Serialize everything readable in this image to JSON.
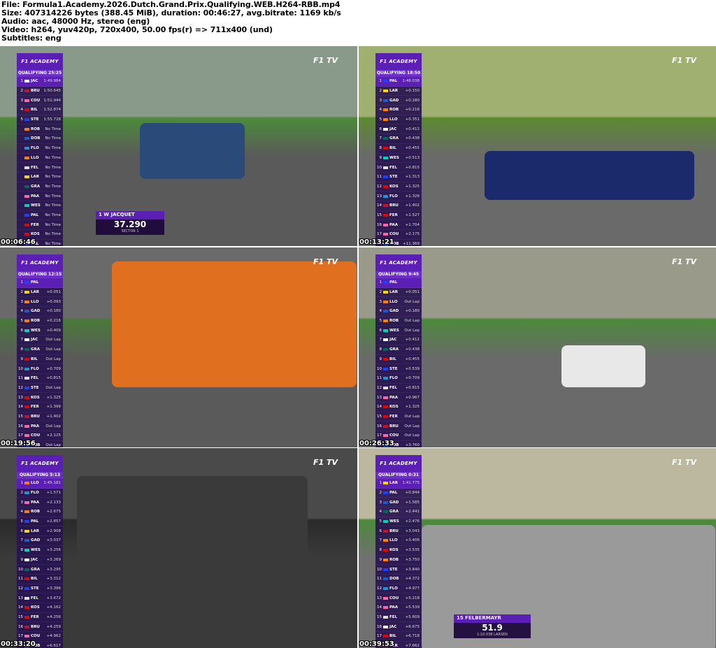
{
  "header": {
    "file": "File: Formula1.Academy.2026.Dutch.Grand.Prix.Qualifying.WEB.H264-RBB.mp4",
    "size": "Size: 407314226 bytes (388.45 MiB), duration: 00:46:27, avg.bitrate: 1169 kb/s",
    "audio": "Audio: aac, 48000 Hz, stereo (eng)",
    "video": "Video: h264, yuv420p, 720x400, 50.00 fps(r) => 711x400 (und)",
    "subtitles": "Subtitles: eng"
  },
  "broadcast": {
    "logo": "F1 ACADEMY",
    "network": "F1 TV"
  },
  "thumbnails": [
    {
      "timestamp": "00:06:46",
      "session": "QUALIFYING 25:25",
      "scene_colors": {
        "sky": "#8a9a8a",
        "track": "#5a5a5a",
        "grass": "#4c8a3a"
      },
      "rows": [
        {
          "p": "1",
          "code": "JAC",
          "gap": "1:49.984",
          "c": "#ffffff"
        },
        {
          "p": "2",
          "code": "BRU",
          "gap": "1:50.645",
          "c": "#c8102e"
        },
        {
          "p": "3",
          "code": "COU",
          "gap": "1:51.944",
          "c": "#ff66aa"
        },
        {
          "p": "4",
          "code": "BIL",
          "gap": "1:52.874",
          "c": "#e10600"
        },
        {
          "p": "5",
          "code": "STE",
          "gap": "1:55.728",
          "c": "#1e41ff"
        },
        {
          "p": "",
          "code": "ROB",
          "gap": "No Time",
          "c": "#ff8000"
        },
        {
          "p": "",
          "code": "DOB",
          "gap": "No Time",
          "c": "#1e5bc6"
        },
        {
          "p": "",
          "code": "FLO",
          "gap": "No Time",
          "c": "#2293d1"
        },
        {
          "p": "",
          "code": "LLO",
          "gap": "No Time",
          "c": "#ff8000"
        },
        {
          "p": "",
          "code": "FEL",
          "gap": "No Time",
          "c": "#dddddd"
        },
        {
          "p": "",
          "code": "LAR",
          "gap": "No Time",
          "c": "#ffd700"
        },
        {
          "p": "",
          "code": "GRA",
          "gap": "No Time",
          "c": "#00665e"
        },
        {
          "p": "",
          "code": "PAA",
          "gap": "No Time",
          "c": "#ff66aa"
        },
        {
          "p": "",
          "code": "WES",
          "gap": "No Time",
          "c": "#00d2be"
        },
        {
          "p": "",
          "code": "PAL",
          "gap": "No Time",
          "c": "#1e41ff"
        },
        {
          "p": "",
          "code": "FER",
          "gap": "No Time",
          "c": "#e10600"
        },
        {
          "p": "",
          "code": "KOS",
          "gap": "No Time",
          "c": "#e10600"
        },
        {
          "p": "",
          "code": "PAL",
          "gap": "No Time",
          "c": "#1e41ff"
        },
        {
          "p": "",
          "code": "GAD",
          "gap": "No Time",
          "c": "#1e5bc6"
        }
      ],
      "lower": {
        "header": "1  W  JACQUET",
        "value": "37.290",
        "sub": "SECTOR 1"
      }
    },
    {
      "timestamp": "00:13:21",
      "session": "QUALIFYING 18:50",
      "scene_colors": {
        "sky": "#a0b070",
        "track": "#6a6a6a",
        "grass": "#5c8a30"
      },
      "rows": [
        {
          "p": "1",
          "code": "PAL",
          "gap": "1:48.038",
          "c": "#1e41ff"
        },
        {
          "p": "2",
          "code": "LAR",
          "gap": "+0.150",
          "c": "#ffd700"
        },
        {
          "p": "3",
          "code": "GAD",
          "gap": "+0.180",
          "c": "#1e5bc6"
        },
        {
          "p": "4",
          "code": "ROB",
          "gap": "+0.216",
          "c": "#ff8000"
        },
        {
          "p": "5",
          "code": "LLO",
          "gap": "+0.351",
          "c": "#ff8000"
        },
        {
          "p": "6",
          "code": "JAC",
          "gap": "+0.412",
          "c": "#ffffff"
        },
        {
          "p": "7",
          "code": "GRA",
          "gap": "+0.438",
          "c": "#00665e"
        },
        {
          "p": "8",
          "code": "BIL",
          "gap": "+0.455",
          "c": "#e10600"
        },
        {
          "p": "9",
          "code": "WES",
          "gap": "+0.513",
          "c": "#00d2be"
        },
        {
          "p": "10",
          "code": "FEL",
          "gap": "+0.815",
          "c": "#dddddd"
        },
        {
          "p": "11",
          "code": "STE",
          "gap": "+1.313",
          "c": "#1e41ff"
        },
        {
          "p": "12",
          "code": "KOS",
          "gap": "+1.325",
          "c": "#e10600"
        },
        {
          "p": "13",
          "code": "FLO",
          "gap": "+1.326",
          "c": "#2293d1"
        },
        {
          "p": "14",
          "code": "BRU",
          "gap": "+1.402",
          "c": "#c8102e"
        },
        {
          "p": "15",
          "code": "FER",
          "gap": "+1.527",
          "c": "#e10600"
        },
        {
          "p": "16",
          "code": "PAA",
          "gap": "+1.704",
          "c": "#ff66aa"
        },
        {
          "p": "17",
          "code": "COU",
          "gap": "+2.175",
          "c": "#ff66aa"
        },
        {
          "p": "18",
          "code": "DOB",
          "gap": "+11.369",
          "c": "#1e5bc6"
        }
      ]
    },
    {
      "timestamp": "00:19:56",
      "session": "QUALIFYING 12:15",
      "scene_colors": {
        "sky": "#6a6a6a",
        "track": "#5a5a5a",
        "grass": "#4a7a3a"
      },
      "rows": [
        {
          "p": "1",
          "code": "PAL",
          "gap": "",
          "c": "#1e41ff"
        },
        {
          "p": "2",
          "code": "LAR",
          "gap": "+0.051",
          "c": "#ffd700"
        },
        {
          "p": "3",
          "code": "LLO",
          "gap": "+0.093",
          "c": "#ff8000"
        },
        {
          "p": "4",
          "code": "GAD",
          "gap": "+0.180",
          "c": "#1e5bc6"
        },
        {
          "p": "5",
          "code": "ROB",
          "gap": "+0.216",
          "c": "#ff8000"
        },
        {
          "p": "6",
          "code": "WES",
          "gap": "+0.409",
          "c": "#00d2be"
        },
        {
          "p": "7",
          "code": "JAC",
          "gap": "Out Lap",
          "c": "#ffffff"
        },
        {
          "p": "8",
          "code": "GRA",
          "gap": "Out Lap",
          "c": "#00665e"
        },
        {
          "p": "9",
          "code": "BIL",
          "gap": "Out Lap",
          "c": "#e10600"
        },
        {
          "p": "10",
          "code": "FLO",
          "gap": "+0.709",
          "c": "#2293d1"
        },
        {
          "p": "11",
          "code": "FEL",
          "gap": "+0.815",
          "c": "#dddddd"
        },
        {
          "p": "12",
          "code": "STE",
          "gap": "Out Lap",
          "c": "#1e41ff"
        },
        {
          "p": "13",
          "code": "KOS",
          "gap": "+1.325",
          "c": "#e10600"
        },
        {
          "p": "14",
          "code": "FER",
          "gap": "+1.399",
          "c": "#e10600"
        },
        {
          "p": "15",
          "code": "BRU",
          "gap": "+1.402",
          "c": "#c8102e"
        },
        {
          "p": "16",
          "code": "PAA",
          "gap": "Out Lap",
          "c": "#ff66aa"
        },
        {
          "p": "17",
          "code": "COU",
          "gap": "+2.125",
          "c": "#ff66aa"
        },
        {
          "p": "18",
          "code": "DOB",
          "gap": "Out Lap",
          "c": "#1e5bc6"
        }
      ]
    },
    {
      "timestamp": "00:26:33",
      "session": "QUALIFYING 9:45",
      "scene_colors": {
        "sky": "#9a9a8a",
        "track": "#6a6a6a",
        "grass": "#4c8a3a"
      },
      "rows": [
        {
          "p": "1",
          "code": "PAL",
          "gap": "",
          "c": "#1e41ff"
        },
        {
          "p": "2",
          "code": "LAR",
          "gap": "+0.051",
          "c": "#ffd700"
        },
        {
          "p": "3",
          "code": "LLO",
          "gap": "Out Lap",
          "c": "#ff8000"
        },
        {
          "p": "4",
          "code": "GAD",
          "gap": "+0.180",
          "c": "#1e5bc6"
        },
        {
          "p": "5",
          "code": "ROB",
          "gap": "Out Lap",
          "c": "#ff8000"
        },
        {
          "p": "6",
          "code": "WES",
          "gap": "Out Lap",
          "c": "#00d2be"
        },
        {
          "p": "7",
          "code": "JAC",
          "gap": "+0.412",
          "c": "#ffffff"
        },
        {
          "p": "8",
          "code": "GRA",
          "gap": "+0.438",
          "c": "#00665e"
        },
        {
          "p": "9",
          "code": "BIL",
          "gap": "+0.455",
          "c": "#e10600"
        },
        {
          "p": "10",
          "code": "STE",
          "gap": "+0.539",
          "c": "#1e41ff"
        },
        {
          "p": "11",
          "code": "FLO",
          "gap": "+0.709",
          "c": "#2293d1"
        },
        {
          "p": "12",
          "code": "FEL",
          "gap": "+0.815",
          "c": "#dddddd"
        },
        {
          "p": "13",
          "code": "PAA",
          "gap": "+0.967",
          "c": "#ff66aa"
        },
        {
          "p": "14",
          "code": "KOS",
          "gap": "+1.325",
          "c": "#e10600"
        },
        {
          "p": "15",
          "code": "FER",
          "gap": "Out Lap",
          "c": "#e10600"
        },
        {
          "p": "16",
          "code": "BRU",
          "gap": "Out Lap",
          "c": "#c8102e"
        },
        {
          "p": "17",
          "code": "COU",
          "gap": "Out Lap",
          "c": "#ff66aa"
        },
        {
          "p": "18",
          "code": "DOB",
          "gap": "+3.760",
          "c": "#1e5bc6"
        }
      ]
    },
    {
      "timestamp": "00:33:20",
      "session": "QUALIFYING 5:13",
      "scene_colors": {
        "sky": "#4a4a4a",
        "track": "#3a3a3a",
        "grass": "#2a2a2a"
      },
      "rows": [
        {
          "p": "1",
          "code": "LLO",
          "gap": "1:45.181",
          "c": "#ff8000"
        },
        {
          "p": "2",
          "code": "FLO",
          "gap": "+1.571",
          "c": "#2293d1"
        },
        {
          "p": "3",
          "code": "PAA",
          "gap": "+2.133",
          "c": "#ff66aa"
        },
        {
          "p": "4",
          "code": "ROB",
          "gap": "+2.675",
          "c": "#ff8000"
        },
        {
          "p": "5",
          "code": "PAL",
          "gap": "+2.857",
          "c": "#1e41ff"
        },
        {
          "p": "6",
          "code": "LAR",
          "gap": "+2.908",
          "c": "#ffd700"
        },
        {
          "p": "7",
          "code": "GAD",
          "gap": "+3.037",
          "c": "#1e5bc6"
        },
        {
          "p": "8",
          "code": "WES",
          "gap": "+3.256",
          "c": "#00d2be"
        },
        {
          "p": "9",
          "code": "JAC",
          "gap": "+3.269",
          "c": "#ffffff"
        },
        {
          "p": "10",
          "code": "GRA",
          "gap": "+3.295",
          "c": "#00665e"
        },
        {
          "p": "11",
          "code": "BIL",
          "gap": "+3.312",
          "c": "#e10600"
        },
        {
          "p": "12",
          "code": "STE",
          "gap": "+3.396",
          "c": "#1e41ff"
        },
        {
          "p": "13",
          "code": "FEL",
          "gap": "+3.672",
          "c": "#dddddd"
        },
        {
          "p": "14",
          "code": "KOS",
          "gap": "+4.162",
          "c": "#e10600"
        },
        {
          "p": "15",
          "code": "FER",
          "gap": "+4.256",
          "c": "#e10600"
        },
        {
          "p": "16",
          "code": "BRU",
          "gap": "+4.259",
          "c": "#c8102e"
        },
        {
          "p": "17",
          "code": "COU",
          "gap": "+4.962",
          "c": "#ff66aa"
        },
        {
          "p": "18",
          "code": "DOB",
          "gap": "+6.617",
          "c": "#1e5bc6"
        }
      ]
    },
    {
      "timestamp": "00:39:53",
      "session": "QUALIFYING 0:31",
      "scene_colors": {
        "sky": "#bcb8a0",
        "track": "#707070",
        "grass": "#4c8a3a"
      },
      "rows": [
        {
          "p": "1",
          "code": "LAR",
          "gap": "1:41.775",
          "c": "#ffd700"
        },
        {
          "p": "2",
          "code": "PAL",
          "gap": "+0.844",
          "c": "#1e41ff"
        },
        {
          "p": "3",
          "code": "GAD",
          "gap": "+1.585",
          "c": "#1e5bc6"
        },
        {
          "p": "4",
          "code": "GRA",
          "gap": "+2.441",
          "c": "#00665e"
        },
        {
          "p": "5",
          "code": "WES",
          "gap": "+2.476",
          "c": "#00d2be"
        },
        {
          "p": "6",
          "code": "BRU",
          "gap": "+3.043",
          "c": "#c8102e"
        },
        {
          "p": "7",
          "code": "LLO",
          "gap": "+3.406",
          "c": "#ff8000"
        },
        {
          "p": "8",
          "code": "KOS",
          "gap": "+3.535",
          "c": "#e10600"
        },
        {
          "p": "9",
          "code": "ROB",
          "gap": "+3.750",
          "c": "#ff8000"
        },
        {
          "p": "10",
          "code": "STE",
          "gap": "+3.840",
          "c": "#1e41ff"
        },
        {
          "p": "11",
          "code": "DOB",
          "gap": "+4.372",
          "c": "#1e5bc6"
        },
        {
          "p": "12",
          "code": "FLO",
          "gap": "+4.977",
          "c": "#2293d1"
        },
        {
          "p": "13",
          "code": "COU",
          "gap": "+5.218",
          "c": "#ff66aa"
        },
        {
          "p": "14",
          "code": "PAA",
          "gap": "+5.539",
          "c": "#ff66aa"
        },
        {
          "p": "15",
          "code": "FEL",
          "gap": "+5.609",
          "c": "#dddddd"
        },
        {
          "p": "16",
          "code": "JAC",
          "gap": "+6.675",
          "c": "#ffffff"
        },
        {
          "p": "17",
          "code": "BIL",
          "gap": "+6.718",
          "c": "#e10600"
        },
        {
          "p": "18",
          "code": "FER",
          "gap": "+7.662",
          "c": "#e10600"
        }
      ],
      "lower": {
        "header": "15  FELBERMAYR",
        "value": "51.9",
        "sub": "1:10.038 LARSEN"
      }
    }
  ]
}
